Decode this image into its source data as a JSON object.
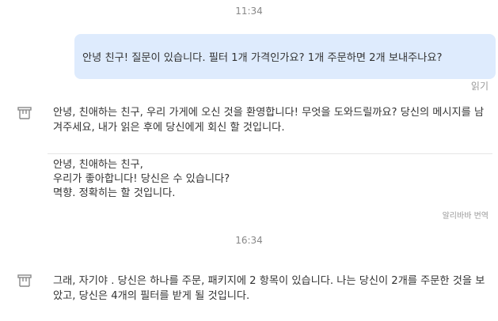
{
  "times": [
    "11:34",
    "16:34"
  ],
  "outgoing": {
    "text": "안녕 친구! 질문이 있습니다. 필터 1개 가격인가요? 1개 주문하면 2개 보내주나요?",
    "status": "읽기"
  },
  "reply1": {
    "avatar_icon": "store-icon",
    "text": "안녕, 친애하는 친구, 우리 가게에 오신 것을 환영합니다! 무엇을 도와드릴까요? 당신의 메시지를 남겨주세요, 내가 읽은 후에 당신에게 회신 할 것입니다."
  },
  "translation": {
    "lines": [
      "안녕, 친애하는 친구,",
      "우리가 좋아합니다! 당신은 수 있습니다?",
      "멱향. 정확히는 할 것입니다."
    ],
    "label": "알리바바 번역"
  },
  "reply2": {
    "avatar_icon": "store-icon",
    "text": "그래, 자기야 . 당신은 하나를 주문, 패키지에 2 항목이 있습니다. 나는 당신이 2개를 주문한 것을 보았고, 당신은 4개의 필터를 받게 될 것입니다."
  }
}
